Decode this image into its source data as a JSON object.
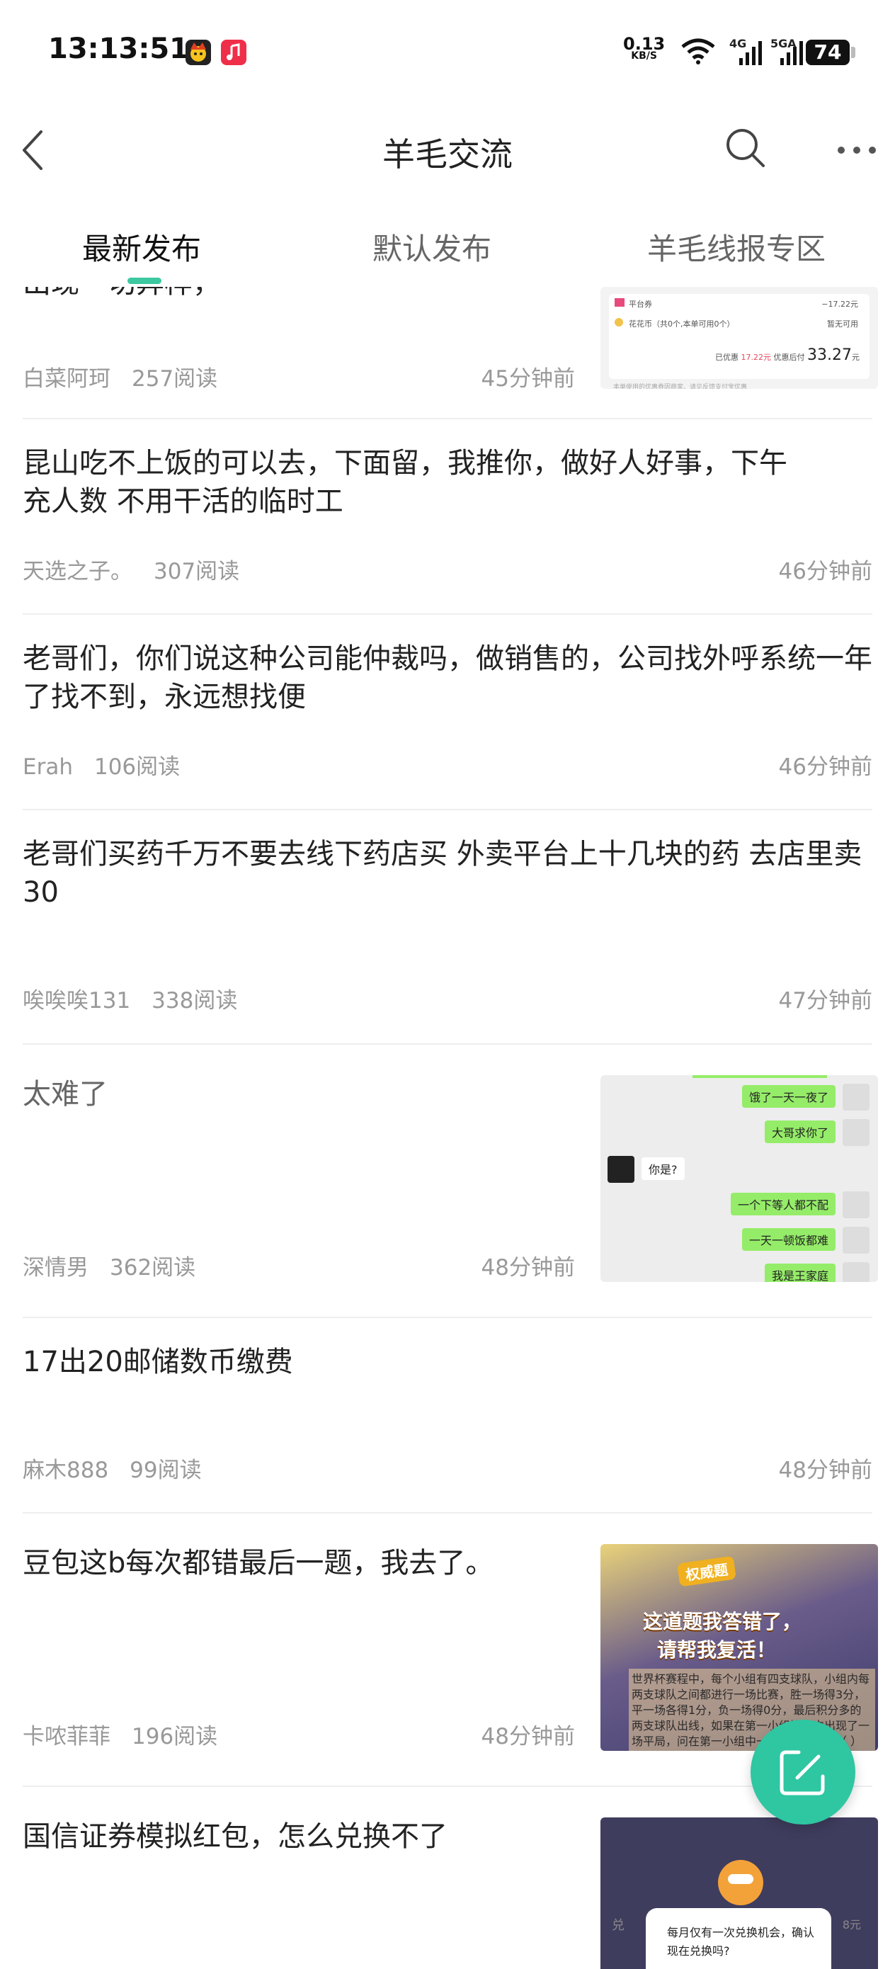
{
  "status_bar": {
    "time": "13:13:51",
    "net_speed_value": "0.13",
    "net_speed_unit": "KB/S",
    "net_4g": "4G",
    "net_5g": "5GA",
    "battery": "74"
  },
  "header": {
    "title": "羊毛交流",
    "back_icon": "chevron-left-icon",
    "search_icon": "search-icon",
    "more_icon": "more-icon"
  },
  "tabs": [
    {
      "label": "最新发布",
      "active": true
    },
    {
      "label": "默认发布",
      "active": false
    },
    {
      "label": "羊毛线报专区",
      "active": false
    }
  ],
  "posts": [
    {
      "title": "出现一切异样，",
      "author": "白菜阿珂",
      "reads": "257阅读",
      "time": "45分钟前",
      "thumb": {
        "row1_label": "平台券",
        "row1_value": "−17.22元",
        "row2_label": "花花币（共0个,本单可用0个）",
        "row2_value": "暂无可用",
        "discount_text": "已优惠",
        "discount_amount": "17.22元",
        "after_text": "优惠后付",
        "price": "33.27",
        "price_unit": "元",
        "note": "本单使用的优惠券因商家、请见反馈支付宝优惠"
      }
    },
    {
      "title": "昆山吃不上饭的可以去，下面留，我推你，做好人好事，下午充人数 不用干活的临时工",
      "author": "天选之子。",
      "reads": "307阅读",
      "time": "46分钟前"
    },
    {
      "title": "老哥们，你们说这种公司能仲裁吗，做销售的，公司找外呼系统一年了找不到，永远想找便",
      "author": "Erah",
      "reads": "106阅读",
      "time": "46分钟前"
    },
    {
      "title": "老哥们买药千万不要去线下药店买 外卖平台上十几块的药 去店里卖30",
      "author": "唉唉唉131",
      "reads": "338阅读",
      "time": "47分钟前"
    },
    {
      "title": "太难了",
      "author": "深情男",
      "reads": "362阅读",
      "time": "48分钟前",
      "chat": [
        "饿了一天一夜了",
        "大哥求你了",
        "你是?",
        "一个下等人都不配",
        "一天一顿饭都难",
        "我是王家庭"
      ]
    },
    {
      "title": "17出20邮储数币缴费",
      "author": "麻木888",
      "reads": "99阅读",
      "time": "48分钟前"
    },
    {
      "title": "豆包这b每次都错最后一题，我去了。",
      "author": "卡哝菲菲",
      "reads": "196阅读",
      "time": "48分钟前",
      "thumb": {
        "badge": "权威题",
        "line1": "这道题我答错了，",
        "line2": "请帮我复活！",
        "body": "世界杯赛程中，每个小组有四支球队，小组内每两支球队之间都进行一场比赛，胜一场得3分，平一场各得1分，负一场得0分，最后积分多的两支球队出线，如果在第一小组比赛中出现了一场平局，问在第一小组中一支球队至少得（ ）分"
      }
    },
    {
      "title": "国信证券模拟红包，怎么兑换不了",
      "author": "",
      "reads": "",
      "time": "",
      "thumb": {
        "dialog_text": "每月仅有一次兑换机会，确认现在兑换吗?",
        "side_text": "兑",
        "side_value": "8元"
      }
    }
  ],
  "fab": {
    "icon": "edit-icon"
  }
}
